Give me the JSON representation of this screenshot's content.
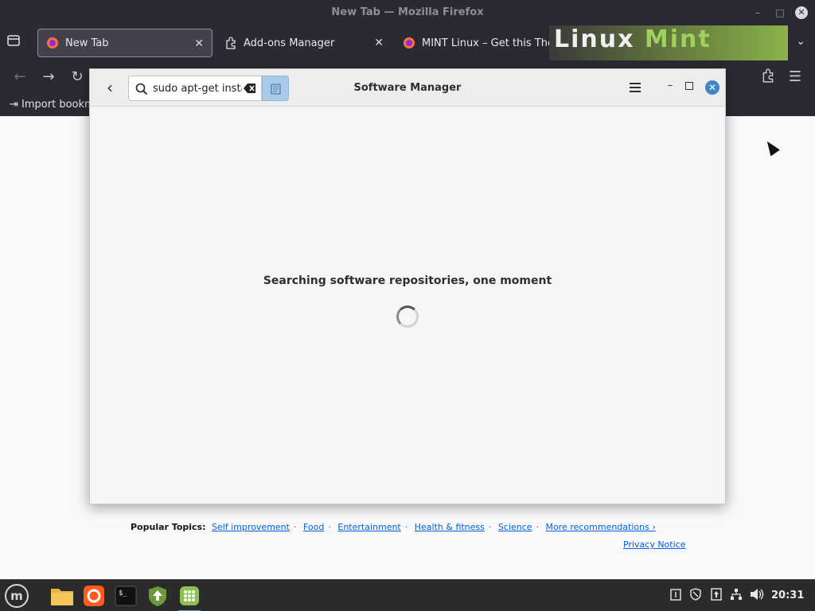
{
  "firefox": {
    "window_title": "New Tab — Mozilla Firefox",
    "tabs": [
      {
        "label": "New Tab",
        "icon": "firefox-icon",
        "active": true
      },
      {
        "label": "Add-ons Manager",
        "icon": "puzzle-icon",
        "active": false
      },
      {
        "label": "MINT Linux – Get this Them",
        "icon": "firefox-icon",
        "active": false
      }
    ],
    "theme_banner_text_a": "Linux",
    "theme_banner_text_b": "Mint",
    "bookmarks": {
      "import_label": "Import bookm"
    }
  },
  "new_tab_page": {
    "popular_topics_label": "Popular Topics:",
    "topics": [
      "Self improvement",
      "Food",
      "Entertainment",
      "Health & fitness",
      "Science",
      "More recommendations ›"
    ],
    "privacy_notice": "Privacy Notice"
  },
  "software_manager": {
    "title": "Software Manager",
    "search": {
      "value": "sudo apt-get insta",
      "placeholder": ""
    },
    "status_text": "Searching software repositories, one moment",
    "accent_color": "#3f86c7"
  },
  "taskbar": {
    "clock": "20:31",
    "launchers": [
      "files-icon",
      "firefox-icon",
      "terminal-icon",
      "update-manager-icon",
      "software-manager-icon"
    ],
    "tray_icons": [
      "notes-icon",
      "shield-icon",
      "updates-icon",
      "network-icon",
      "volume-icon"
    ]
  }
}
